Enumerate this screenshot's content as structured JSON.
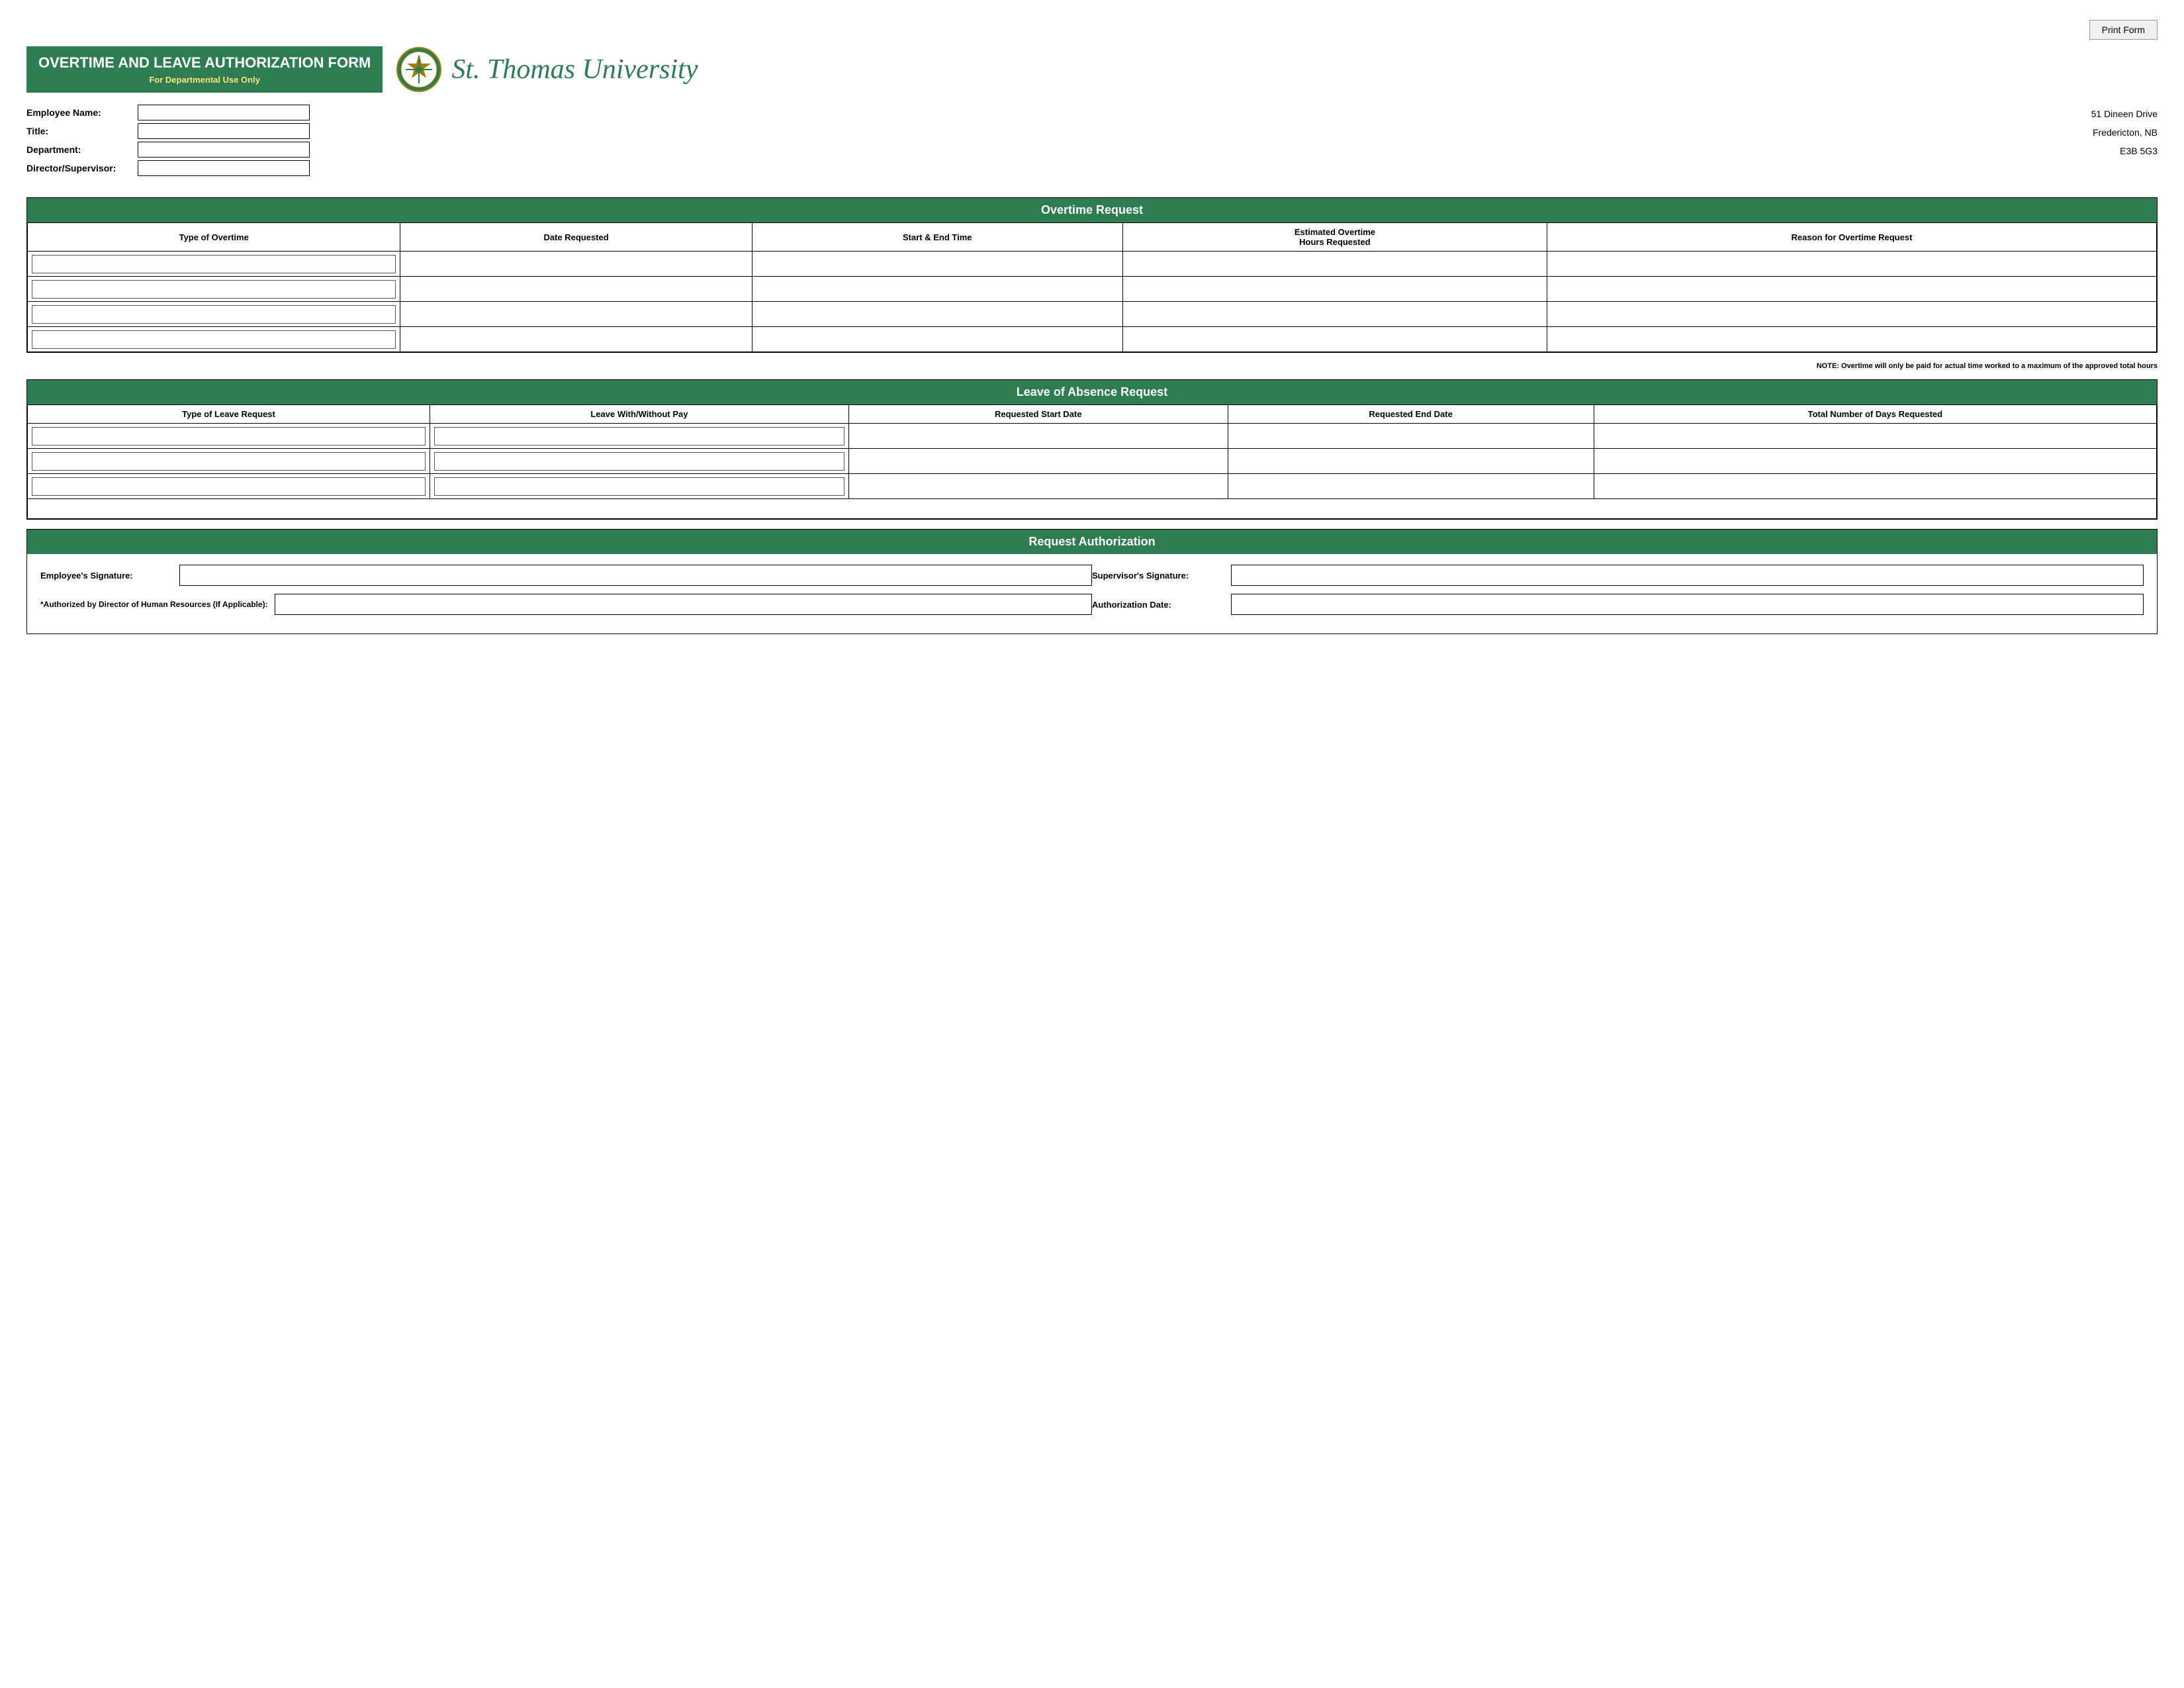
{
  "printButton": "Print Form",
  "formTitle": "OVERTIME AND LEAVE AUTHORIZATION FORM",
  "formSubtitle": "For Departmental Use Only",
  "university": "St. Thomas University",
  "address": {
    "line1": "51 Dineen Drive",
    "line2": "Fredericton, NB",
    "line3": "E3B 5G3"
  },
  "fields": {
    "employeeNameLabel": "Employee Name:",
    "titleLabel": "Title:",
    "departmentLabel": "Department:",
    "directorLabel": "Director/Supervisor:"
  },
  "overtime": {
    "sectionTitle": "Overtime Request",
    "columns": [
      "Type of Overtime",
      "Date Requested",
      "Start & End Time",
      "Estimated Overtime Hours Requested",
      "Reason for Overtime Request"
    ],
    "note": "NOTE: Overtime will only be paid for actual time worked to a maximum of the approved total hours",
    "rows": 4
  },
  "leave": {
    "sectionTitle": "Leave of Absence Request",
    "columns": [
      "Type of Leave Request",
      "Leave With/Without Pay",
      "Requested Start Date",
      "Requested End Date",
      "Total Number of Days Requested"
    ],
    "rows": 3
  },
  "authorization": {
    "sectionTitle": "Request Authorization",
    "employeeSigLabel": "Employee's Signature:",
    "supervisorSigLabel": "Supervisor's Signature:",
    "authorizedLabel": "*Authorized by Director of Human Resources (If Applicable):",
    "authDateLabel": "Authorization Date:"
  }
}
